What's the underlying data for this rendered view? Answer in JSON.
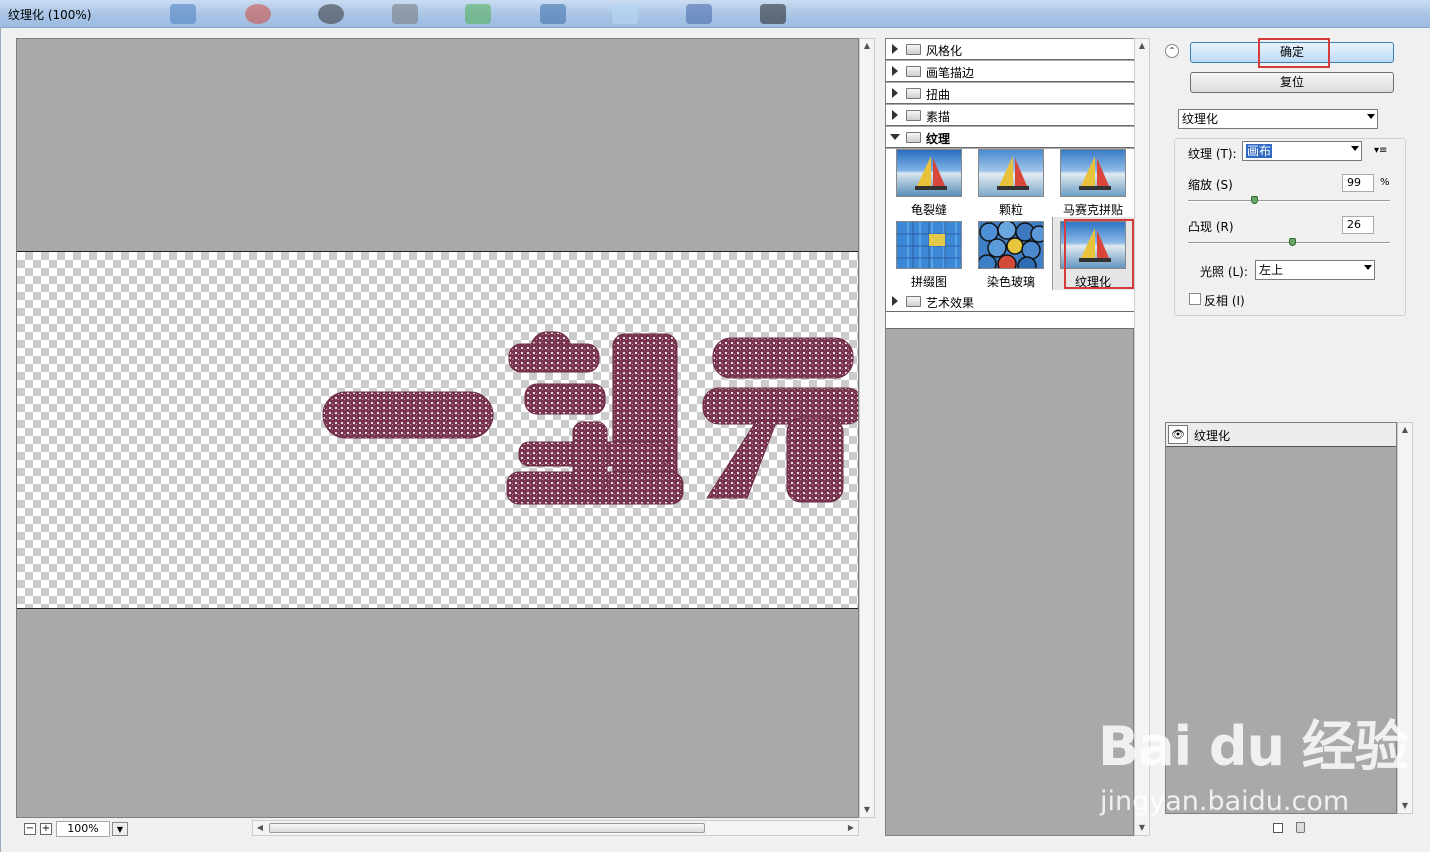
{
  "window": {
    "title": "纹理化 (100%)"
  },
  "preview": {
    "zoom": "100%",
    "zoom_out": "−",
    "zoom_in": "+"
  },
  "gallery": {
    "categories_top": [
      {
        "label": "风格化"
      },
      {
        "label": "画笔描边"
      },
      {
        "label": "扭曲"
      },
      {
        "label": "素描"
      }
    ],
    "expanded_category": "纹理",
    "filters": [
      {
        "label": "龟裂缝"
      },
      {
        "label": "颗粒"
      },
      {
        "label": "马赛克拼贴"
      },
      {
        "label": "拼缀图"
      },
      {
        "label": "染色玻璃"
      },
      {
        "label": "纹理化"
      }
    ],
    "selected_filter": "纹理化",
    "categories_bottom": [
      {
        "label": "艺术效果"
      }
    ]
  },
  "buttons": {
    "ok": "确定",
    "reset": "复位"
  },
  "filter_select": {
    "value": "纹理化"
  },
  "settings": {
    "texture_label": "纹理 (T):",
    "texture_value": "画布",
    "scaling_label": "缩放 (S)",
    "scaling_value": "99",
    "scaling_unit": "%",
    "scaling_fraction": 0.33,
    "relief_label": "凸现 (R)",
    "relief_value": "26",
    "relief_fraction": 0.52,
    "light_label": "光照 (L):",
    "light_value": "左上",
    "invert_label": "反相 (I)",
    "invert_checked": false
  },
  "layers": {
    "items": [
      {
        "label": "纹理化"
      }
    ]
  },
  "watermark": {
    "logo": "Bai du 经验",
    "url": "jingyan.baidu.com"
  },
  "colors": {
    "texture": "#7a3550",
    "highlight": "#d43b3b",
    "ok_button": "#bcdaf5"
  }
}
